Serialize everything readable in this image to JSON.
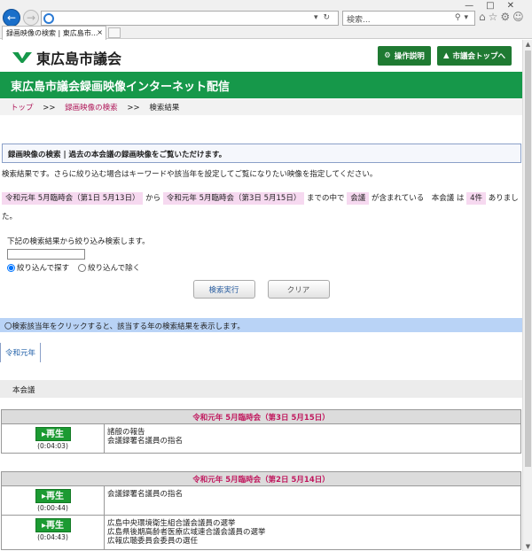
{
  "browser": {
    "search_placeholder": "検索...",
    "tab_title": "録画映像の検索 | 東広島市..."
  },
  "site": {
    "logo_text": "東広島市議会",
    "help_button": "操作説明",
    "top_button": "市議会トップへ",
    "banner_title": "東広島市議会録画映像インターネット配信"
  },
  "breadcrumb": {
    "home": "トップ",
    "search": "録画映像の検索",
    "current": "検索結果",
    "sep": ">>"
  },
  "notice": "録画映像の検索 | 過去の本会議の録画映像をご覧いただけます。",
  "lead": "検索結果です。さらに絞り込む場合はキーワードや該当年を設定してご覧になりたい映像を指定してください。",
  "conditions": {
    "from": "令和元年 5月臨時会（第1日 5月13日）",
    "from_sep": "から",
    "to": "令和元年 5月臨時会（第3日 5月15日）",
    "to_sep": "までの中で",
    "keyword": "会議",
    "keyword_sep": "が含まれている　本会議 は",
    "count": "4件",
    "tail": "ありました。"
  },
  "refine": {
    "label": "下記の検索結果から絞り込み検索します。",
    "value": "",
    "radio_narrow": "絞り込んで探す",
    "radio_exclude": "絞り込んで除く",
    "search_button": "検索実行",
    "clear_button": "クリア"
  },
  "year_hint": "〇検索該当年をクリックすると、該当する年の検索結果を表示します。",
  "year_tab": "令和元年",
  "session_type": "本会議",
  "meetings": [
    {
      "title": "令和元年 5月臨時会（第3日 5月15日）",
      "rows": [
        {
          "play": "再生",
          "duration": "(0:04:03)",
          "items": [
            "諸般の報告",
            "会議録署名議員の指名"
          ]
        }
      ]
    },
    {
      "title": "令和元年 5月臨時会（第2日 5月14日）",
      "rows": [
        {
          "play": "再生",
          "duration": "(0:00:44)",
          "items": [
            "会議録署名議員の指名"
          ]
        },
        {
          "play": "再生",
          "duration": "(0:04:43)",
          "items": [
            "広島中央環境衛生組合議会議員の選挙",
            "広島県後期高齢者医療広域連合議会議員の選挙",
            "広報広聴委員会委員の選任"
          ]
        }
      ]
    }
  ]
}
